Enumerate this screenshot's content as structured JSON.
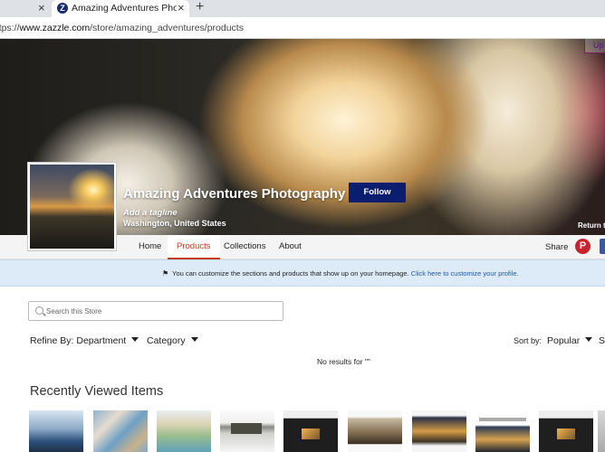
{
  "browser": {
    "tab_title": "Amazing Adventures Photography",
    "url_scheme": "https://",
    "url_host": "www.zazzle.com",
    "url_path": "/store/amazing_adventures/products",
    "close_glyph": "×",
    "new_tab_glyph": "+",
    "favicon_letter": "Z"
  },
  "banner": {
    "corner_button": "Up",
    "store_name": "Amazing Adventures Photography",
    "tagline": "Add a tagline",
    "location": "Washington, United States",
    "follow_label": "Follow",
    "return_label": "Return to"
  },
  "nav": {
    "items": [
      {
        "label": "Home"
      },
      {
        "label": "Products",
        "active": true
      },
      {
        "label": "Collections"
      },
      {
        "label": "About"
      }
    ],
    "share_label": "Share",
    "pinterest_glyph": "P"
  },
  "info": {
    "message": "You can customize the sections and products that show up on your homepage.",
    "link": "Click here to customize your profile."
  },
  "search": {
    "placeholder": "Search this Store"
  },
  "filters": {
    "refine_label": "Refine By: Department",
    "category_label": "Category",
    "sort_label": "Sort by:",
    "sort_value": "Popular",
    "sort_more": "Sh"
  },
  "results": {
    "empty_message": "No results for \"\""
  },
  "recent": {
    "title": "Recently Viewed Items"
  },
  "colors": {
    "accent": "#c73b1b",
    "follow_button": "#0b1d6e",
    "info_bar": "#dcebf7",
    "link": "#1f58a8"
  }
}
